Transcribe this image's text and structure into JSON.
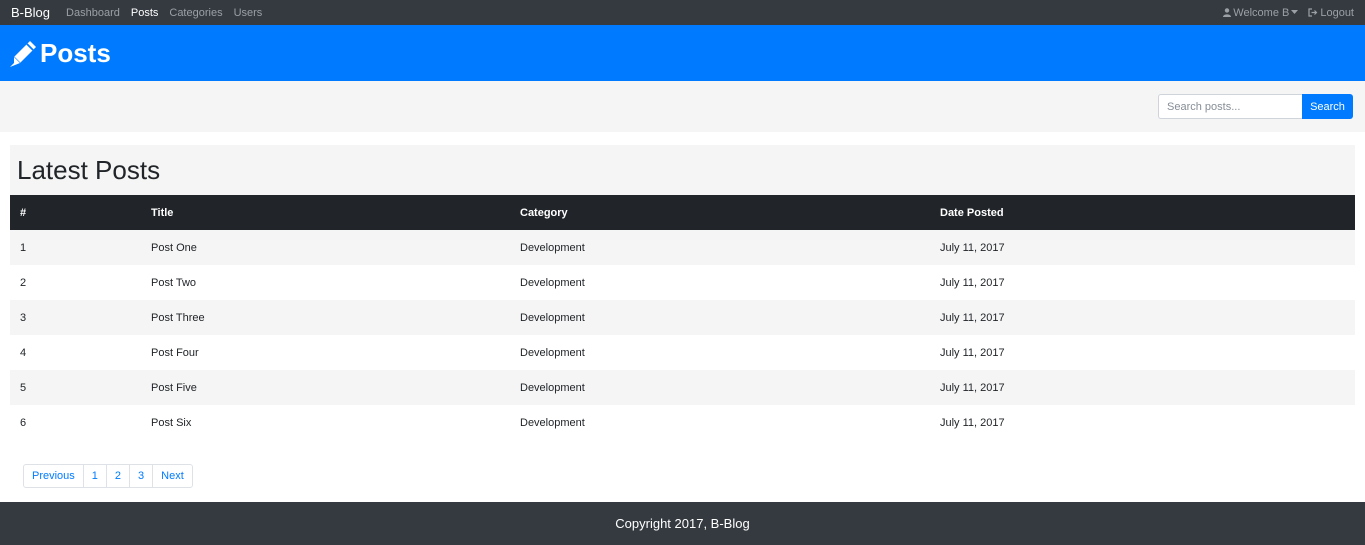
{
  "navbar": {
    "brand": "B-Blog",
    "links": [
      {
        "label": "Dashboard",
        "active": false
      },
      {
        "label": "Posts",
        "active": true
      },
      {
        "label": "Categories",
        "active": false
      },
      {
        "label": "Users",
        "active": false
      }
    ],
    "welcome": "Welcome B",
    "logout": "Logout"
  },
  "header": {
    "title": "Posts",
    "icon": "pencil-icon"
  },
  "search": {
    "placeholder": "Search posts...",
    "value": "",
    "button": "Search"
  },
  "posts": {
    "title": "Latest Posts",
    "columns": [
      "#",
      "Title",
      "Category",
      "Date Posted"
    ],
    "rows": [
      [
        "1",
        "Post One",
        "Development",
        "July 11, 2017"
      ],
      [
        "2",
        "Post Two",
        "Development",
        "July 11, 2017"
      ],
      [
        "3",
        "Post Three",
        "Development",
        "July 11, 2017"
      ],
      [
        "4",
        "Post Four",
        "Development",
        "July 11, 2017"
      ],
      [
        "5",
        "Post Five",
        "Development",
        "July 11, 2017"
      ],
      [
        "6",
        "Post Six",
        "Development",
        "July 11, 2017"
      ]
    ]
  },
  "pagination": {
    "previous": "Previous",
    "pages": [
      "1",
      "2",
      "3"
    ],
    "next": "Next"
  },
  "footer": {
    "text": "Copyright 2017, B-Blog"
  },
  "colors": {
    "primary": "#007bff",
    "dark": "#343a40",
    "table_head": "#212529",
    "stripe": "#f5f5f5"
  }
}
